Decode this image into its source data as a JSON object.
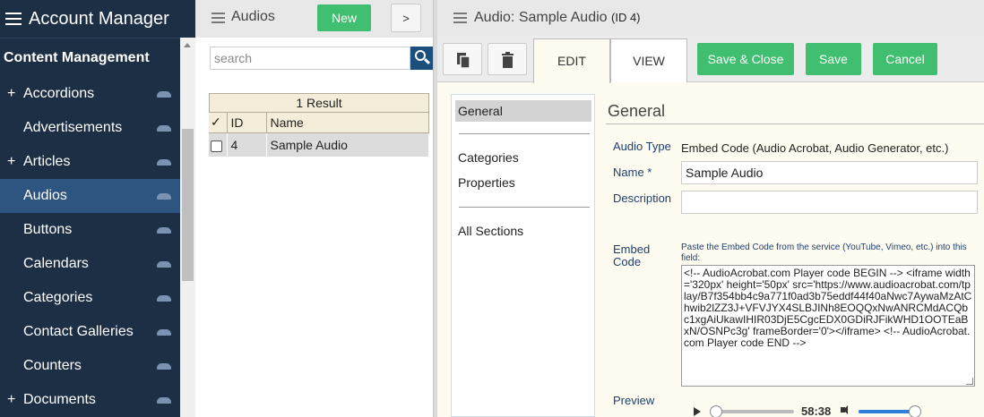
{
  "sidebar": {
    "title": "Account Manager",
    "section": "Content Management",
    "items": [
      {
        "label": "Accordions",
        "expandable": "+"
      },
      {
        "label": "Advertisements",
        "expandable": ""
      },
      {
        "label": "Articles",
        "expandable": "+"
      },
      {
        "label": "Audios",
        "expandable": "",
        "active": true
      },
      {
        "label": "Buttons",
        "expandable": ""
      },
      {
        "label": "Calendars",
        "expandable": ""
      },
      {
        "label": "Categories",
        "expandable": ""
      },
      {
        "label": "Contact Galleries",
        "expandable": ""
      },
      {
        "label": "Counters",
        "expandable": ""
      },
      {
        "label": "Documents",
        "expandable": "+"
      }
    ]
  },
  "list": {
    "title": "Audios",
    "new_label": "New",
    "expand_label": ">",
    "search_placeholder": "search",
    "result_count": "1 Result",
    "columns": {
      "check": "✓",
      "id": "ID",
      "name": "Name"
    },
    "rows": [
      {
        "id": "4",
        "name": "Sample Audio"
      }
    ]
  },
  "editor": {
    "title": "Audio: Sample Audio",
    "title_id": "(ID 4)",
    "tabs": {
      "edit": "EDIT",
      "view": "VIEW"
    },
    "actions": {
      "save_close": "Save & Close",
      "save": "Save",
      "cancel": "Cancel"
    },
    "nav": {
      "general": "General",
      "categories": "Categories",
      "properties": "Properties",
      "all_sections": "All Sections"
    },
    "form": {
      "heading": "General",
      "audio_type_label": "Audio Type",
      "audio_type_value": "Embed Code (Audio Acrobat, Audio Generator, etc.)",
      "name_label": "Name *",
      "name_value": "Sample Audio",
      "description_label": "Description",
      "description_value": "",
      "embed_label_1": "Embed",
      "embed_label_2": "Code",
      "embed_hint": "Paste the Embed Code from the service (YouTube, Vimeo, etc.) into this field:",
      "embed_code": "<!-- AudioAcrobat.com Player code BEGIN --> <iframe width='320px' height='50px' src='https://www.audioacrobat.com/tplay/B7f354bb4c9a771f0ad3b75eddf44f40aNwc7AywaMzAtChwib2lZZ3J+VFVJYX4SLBJINh8EOQQxNwANRCMdACQbc1xgAiUkawIHIR03DjE5CgcEDX0GDiRJFikWHD1OOTEaBxN/OSNPc3g' frameBorder='0'></iframe> <!-- AudioAcrobat.com Player code END -->",
      "preview_label": "Preview",
      "player_time": "58:38"
    }
  },
  "colors": {
    "sidebar_bg": "#1d2f44",
    "sidebar_active": "#2e5580",
    "accent_green": "#3fbf6f",
    "form_bg": "#fefcf1"
  },
  "icons": {
    "menu": "hamburger-icon",
    "search": "search-icon",
    "copy": "copy-icon",
    "delete": "trash-icon",
    "play": "play-icon",
    "volume": "volume-icon"
  }
}
